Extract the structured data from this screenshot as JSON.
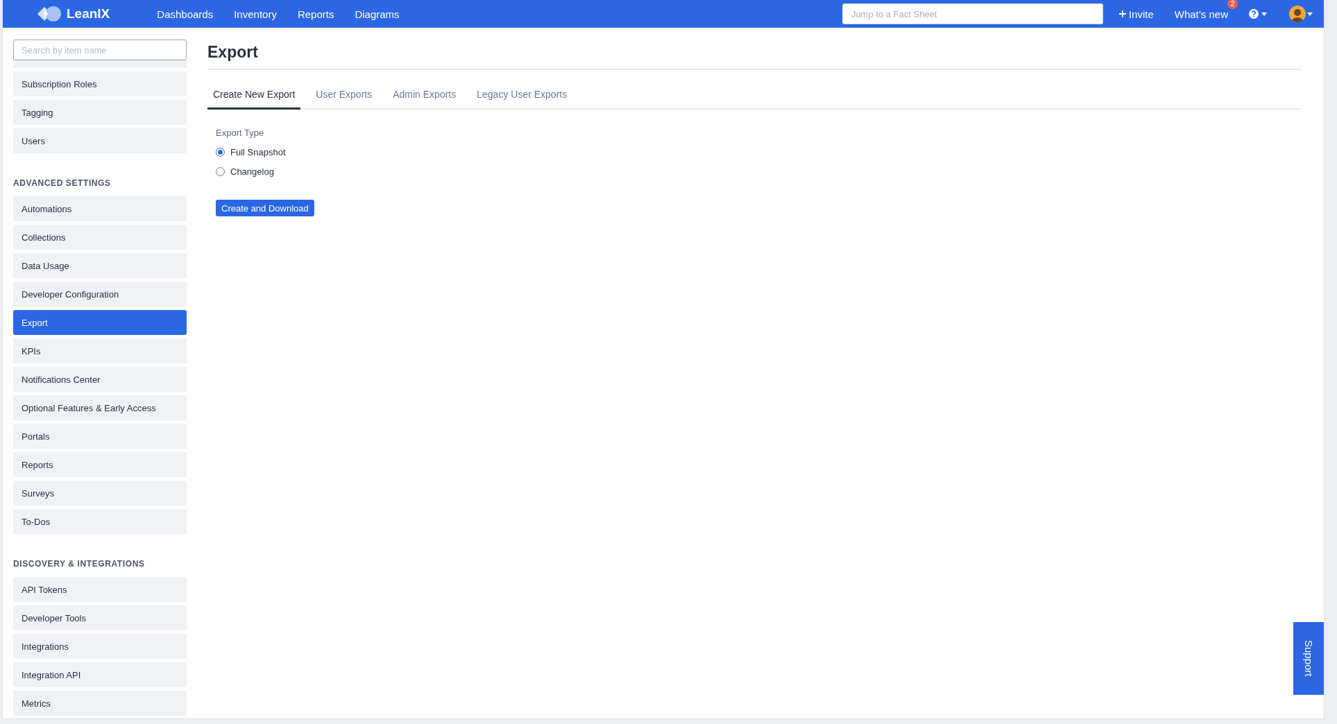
{
  "top_nav": {
    "logo": "LeanIX",
    "links": [
      {
        "label": "Dashboards"
      },
      {
        "label": "Inventory"
      },
      {
        "label": "Reports"
      },
      {
        "label": "Diagrams"
      }
    ],
    "search": {
      "placeholder": "Jump to a Fact Sheet"
    },
    "invite": "Invite",
    "whats_new": {
      "label": "What’s new",
      "badge": "2"
    }
  },
  "sidebar": {
    "search": {
      "placeholder": "Search by item name"
    },
    "groups": [
      {
        "items": [
          {
            "label": "Subscription Roles",
            "selected": false
          },
          {
            "label": "Tagging",
            "selected": false
          },
          {
            "label": "Users",
            "selected": false
          }
        ]
      },
      {
        "heading": "ADVANCED SETTINGS",
        "items": [
          {
            "label": "Automations",
            "selected": false
          },
          {
            "label": "Collections",
            "selected": false
          },
          {
            "label": "Data Usage",
            "selected": false
          },
          {
            "label": "Developer Configuration",
            "selected": false
          },
          {
            "label": "Export",
            "selected": true
          },
          {
            "label": "KPIs",
            "selected": false
          },
          {
            "label": "Notifications Center",
            "selected": false
          },
          {
            "label": "Optional Features & Early Access",
            "selected": false
          },
          {
            "label": "Portals",
            "selected": false
          },
          {
            "label": "Reports",
            "selected": false
          },
          {
            "label": "Surveys",
            "selected": false
          },
          {
            "label": "To-Dos",
            "selected": false
          }
        ]
      },
      {
        "heading": "DISCOVERY & INTEGRATIONS",
        "items": [
          {
            "label": "API Tokens",
            "selected": false
          },
          {
            "label": "Developer Tools",
            "selected": false
          },
          {
            "label": "Integrations",
            "selected": false
          },
          {
            "label": "Integration API",
            "selected": false
          },
          {
            "label": "Metrics",
            "selected": false
          }
        ]
      }
    ]
  },
  "page": {
    "title": "Export",
    "tabs": [
      {
        "label": "Create New Export",
        "selected": true
      },
      {
        "label": "User Exports",
        "selected": false
      },
      {
        "label": "Admin Exports",
        "selected": false
      },
      {
        "label": "Legacy User Exports",
        "selected": false
      }
    ],
    "export_type": {
      "label": "Export Type",
      "options": [
        {
          "label": "Full Snapshot",
          "selected": true
        },
        {
          "label": "Changelog",
          "selected": false
        }
      ]
    },
    "button": "Create and Download"
  },
  "support": "Support"
}
